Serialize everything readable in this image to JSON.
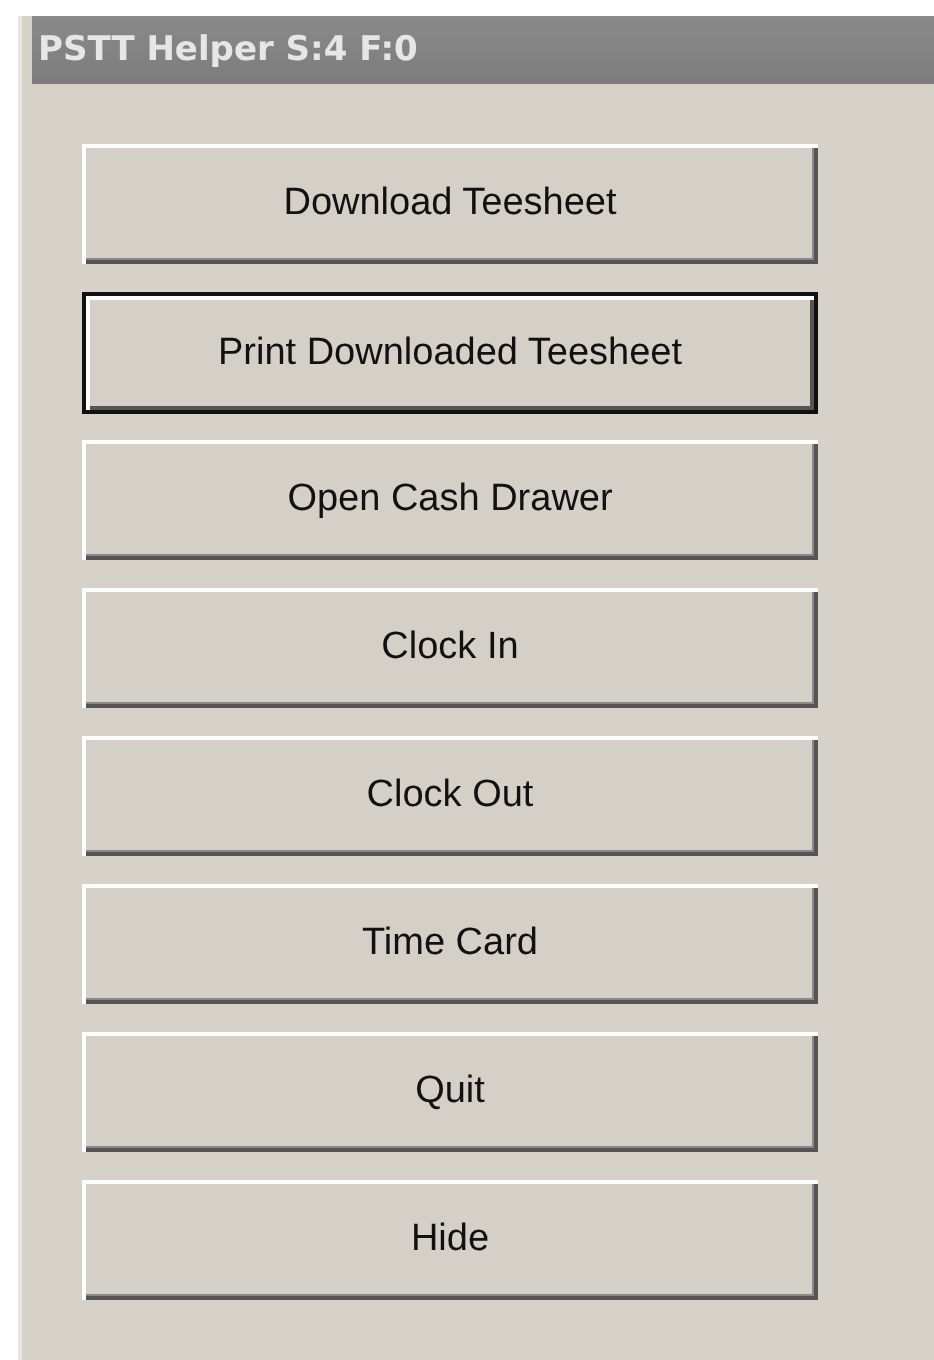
{
  "window": {
    "title": "PSTT Helper S:4 F:0"
  },
  "buttons": [
    {
      "label": "Download Teesheet",
      "focused": false
    },
    {
      "label": "Print Downloaded Teesheet",
      "focused": true
    },
    {
      "label": "Open Cash Drawer",
      "focused": false
    },
    {
      "label": "Clock In",
      "focused": false
    },
    {
      "label": "Clock Out",
      "focused": false
    },
    {
      "label": "Time Card",
      "focused": false
    },
    {
      "label": "Quit",
      "focused": false
    },
    {
      "label": "Hide",
      "focused": false
    }
  ]
}
